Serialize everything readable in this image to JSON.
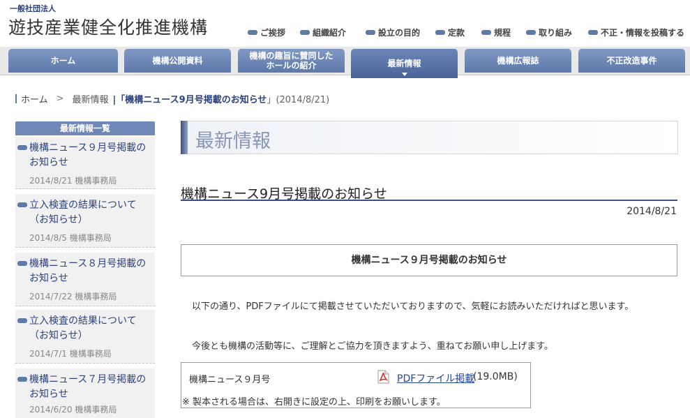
{
  "header": {
    "org_sub": "一般社団法人",
    "org_name": "遊技産業健全化推進機構",
    "util_links": [
      {
        "label": "ご挨拶"
      },
      {
        "label": "組織紹介"
      },
      {
        "label": "設立の目的"
      },
      {
        "label": "定款"
      },
      {
        "label": "規程"
      },
      {
        "label": "取り組み"
      },
      {
        "label": "不正・情報を投稿する"
      }
    ]
  },
  "nav": {
    "items": [
      {
        "label": "ホーム"
      },
      {
        "label": "機構公開資料"
      },
      {
        "label": "機構の趣旨に賛同した\nホールの紹介"
      },
      {
        "label": "最新情報"
      },
      {
        "label": "機構広報誌"
      },
      {
        "label": "不正改造事件"
      }
    ],
    "active_index": 3
  },
  "breadcrumb": {
    "home": "ホーム",
    "sep": ">",
    "section": "最新情報",
    "current_prefix": "|「",
    "current": "機構ニュース9月号掲載のお知らせ",
    "current_suffix": "」(2014/8/21)"
  },
  "sidebar": {
    "heading": "最新情報一覧",
    "items": [
      {
        "title": "機構ニュース９月号掲載のお知らせ",
        "meta": "2014/8/21 機構事務局"
      },
      {
        "title": "立入検査の結果について（お知らせ）",
        "meta": "2014/8/5 機構事務局"
      },
      {
        "title": "機構ニュース８月号掲載のお知らせ",
        "meta": "2014/7/22 機構事務局"
      },
      {
        "title": "立入検査の結果について（お知らせ）",
        "meta": "2014/7/1 機構事務局"
      },
      {
        "title": "機構ニュース７月号掲載のお知らせ",
        "meta": "2014/6/20 機構事務局"
      }
    ]
  },
  "main": {
    "section_title": "最新情報",
    "article_title": "機構ニュース9月号掲載のお知らせ",
    "article_date": "2014/8/21",
    "notice_title": "機構ニュース９月号掲載のお知らせ",
    "para1": "以下の通り、PDFファイルにて掲載させていただいておりますので、気軽にお読みいただければと思います。",
    "para2": "今後とも機構の活動等に、ご理解とご協力を頂きますよう、重ねてお願い申し上げます。",
    "download": {
      "label": "機構ニュース９月号",
      "link_text": "PDFファイル掲載",
      "size": "(19.0MB)",
      "note": "※ 製本される場合は、右開きに設定の上、印刷をお願いします。"
    }
  },
  "colors": {
    "brand": "#5f7aa6",
    "link": "#23449a"
  }
}
